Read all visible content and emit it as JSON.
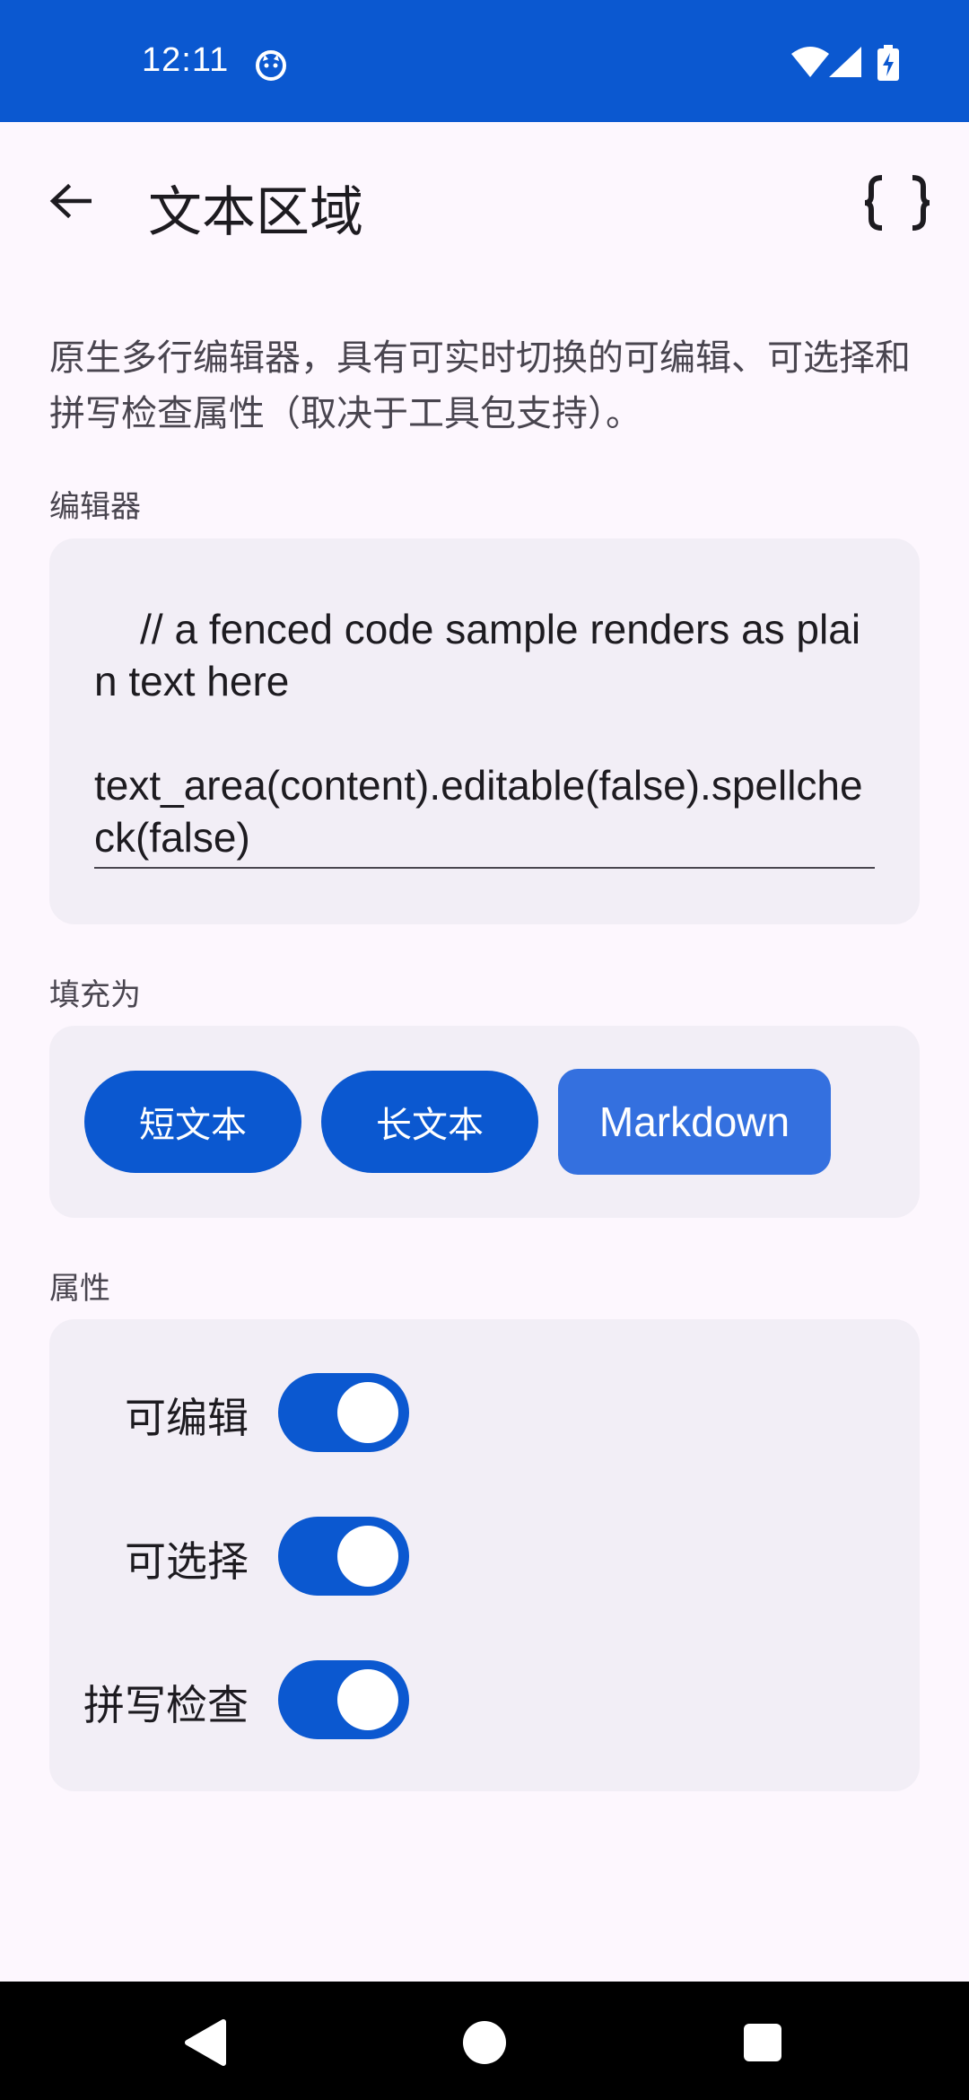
{
  "status_bar": {
    "time": "12:11",
    "icons": [
      "notification-cat-icon",
      "wifi-icon",
      "signal-icon",
      "battery-charging-icon"
    ]
  },
  "app_bar": {
    "title": "文本区域",
    "back_icon": "arrow-back-icon",
    "action_icon": "code-braces-icon"
  },
  "description": "原生多行编辑器，具有可实时切换的可编辑、可选择和拼写检查属性（取决于工具包支持）。",
  "editor": {
    "label": "编辑器",
    "content": "    // a fenced code sample renders as plain text here\n\ntext_area(content).editable(false).spellcheck(false)"
  },
  "fill": {
    "label": "填充为",
    "buttons": [
      {
        "label": "短文本",
        "selected": false
      },
      {
        "label": "长文本",
        "selected": false
      },
      {
        "label": "Markdown",
        "selected": true
      }
    ]
  },
  "properties": {
    "label": "属性",
    "items": [
      {
        "label": "可编辑",
        "on": true
      },
      {
        "label": "可选择",
        "on": true
      },
      {
        "label": "拼写检查",
        "on": true
      }
    ]
  },
  "nav_bar": {
    "icons": [
      "back-triangle-icon",
      "home-circle-icon",
      "recents-square-icon"
    ]
  },
  "colors": {
    "primary": "#0B58D0",
    "selected_button": "#3470DF",
    "background": "#FDF7FE",
    "card": "#F2EEF6"
  }
}
